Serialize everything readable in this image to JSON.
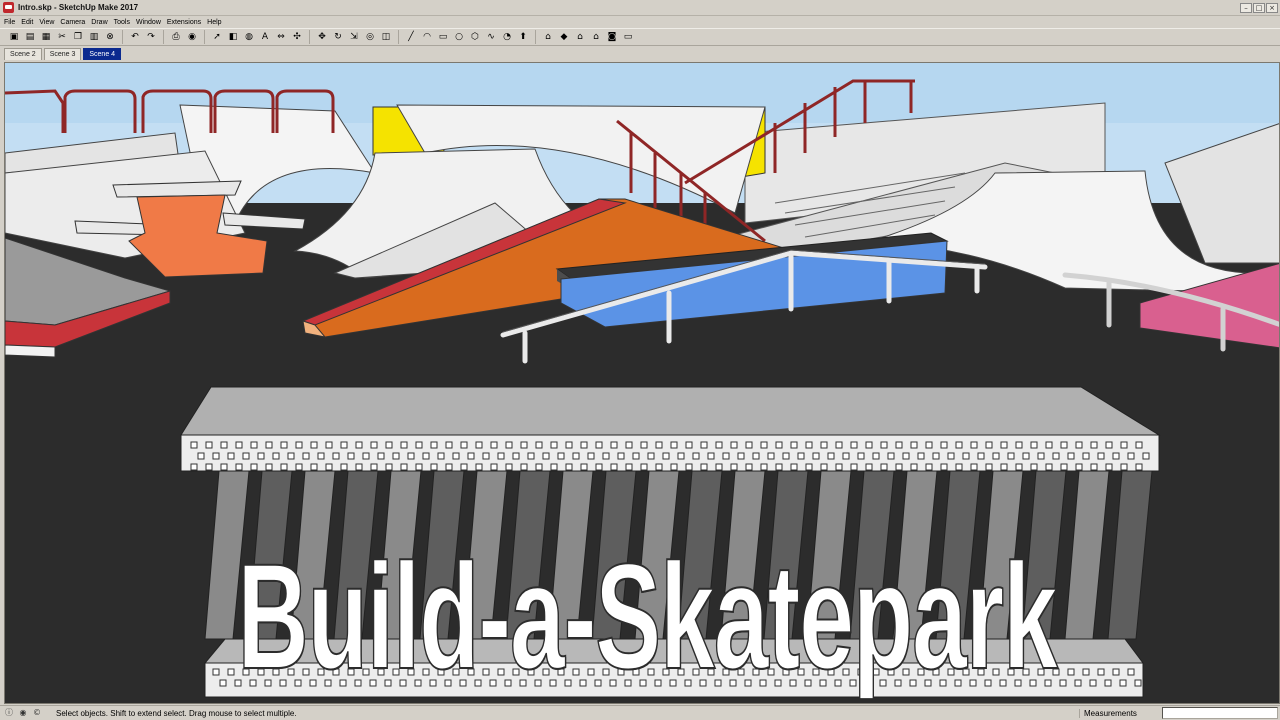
{
  "window": {
    "title": "Intro.skp - SketchUp Make 2017",
    "minimize_glyph": "–",
    "maximize_glyph": "□",
    "close_glyph": "×"
  },
  "menu": [
    "File",
    "Edit",
    "View",
    "Camera",
    "Draw",
    "Tools",
    "Window",
    "Extensions",
    "Help"
  ],
  "toolbar_groups": [
    [
      "new-file-icon",
      "open-file-icon",
      "save-icon",
      "cut-icon",
      "copy-icon",
      "paste-icon",
      "erase-icon"
    ],
    [
      "undo-icon",
      "redo-icon"
    ],
    [
      "print-icon",
      "model-info-icon"
    ],
    [
      "select-icon",
      "eraser-icon",
      "paint-bucket-icon",
      "text-icon",
      "tape-measure-icon",
      "axes-icon"
    ],
    [
      "move-icon",
      "rotate-icon",
      "scale-icon",
      "follow-me-icon",
      "offset-icon"
    ],
    [
      "line-icon",
      "arc-icon",
      "rectangle-icon",
      "circle-icon",
      "polygon-icon",
      "freehand-icon",
      "pie-icon",
      "push-pull-icon"
    ],
    [
      "warehouse-icon",
      "component-icon",
      "home-icon",
      "house-icon",
      "camera-icon",
      "section-icon"
    ]
  ],
  "toolbar_glyphs": {
    "new-file-icon": "▣",
    "open-file-icon": "▤",
    "save-icon": "▦",
    "cut-icon": "✂",
    "copy-icon": "❐",
    "paste-icon": "▥",
    "erase-icon": "⊗",
    "undo-icon": "↶",
    "redo-icon": "↷",
    "print-icon": "⎙",
    "model-info-icon": "◉",
    "select-icon": "➚",
    "eraser-icon": "◧",
    "paint-bucket-icon": "◍",
    "text-icon": "A",
    "tape-measure-icon": "⇔",
    "axes-icon": "✣",
    "move-icon": "✥",
    "rotate-icon": "↻",
    "scale-icon": "⇲",
    "follow-me-icon": "◎",
    "offset-icon": "◫",
    "line-icon": "╱",
    "arc-icon": "◠",
    "rectangle-icon": "▭",
    "circle-icon": "○",
    "polygon-icon": "⬡",
    "freehand-icon": "∿",
    "pie-icon": "◔",
    "push-pull-icon": "⬆",
    "warehouse-icon": "⌂",
    "component-icon": "◆",
    "home-icon": "⌂",
    "house-icon": "⌂",
    "camera-icon": "◙",
    "section-icon": "▭"
  },
  "scene_tabs": [
    {
      "label": "Scene 2",
      "active": false
    },
    {
      "label": "Scene 3",
      "active": false
    },
    {
      "label": "Scene 4",
      "active": true
    }
  ],
  "viewport": {
    "overlay_title": "Build-a-Skatepark",
    "sky_color": "#b9d9f2",
    "ground_color": "#2c2c2c"
  },
  "status": {
    "icons": [
      "info-icon",
      "geo-location-icon",
      "credits-icon"
    ],
    "icon_glyphs": [
      "ⓘ",
      "◉",
      "©"
    ],
    "text": "Select objects. Shift to extend select. Drag mouse to select multiple.",
    "measurements_label": "Measurements",
    "measurements_value": ""
  }
}
